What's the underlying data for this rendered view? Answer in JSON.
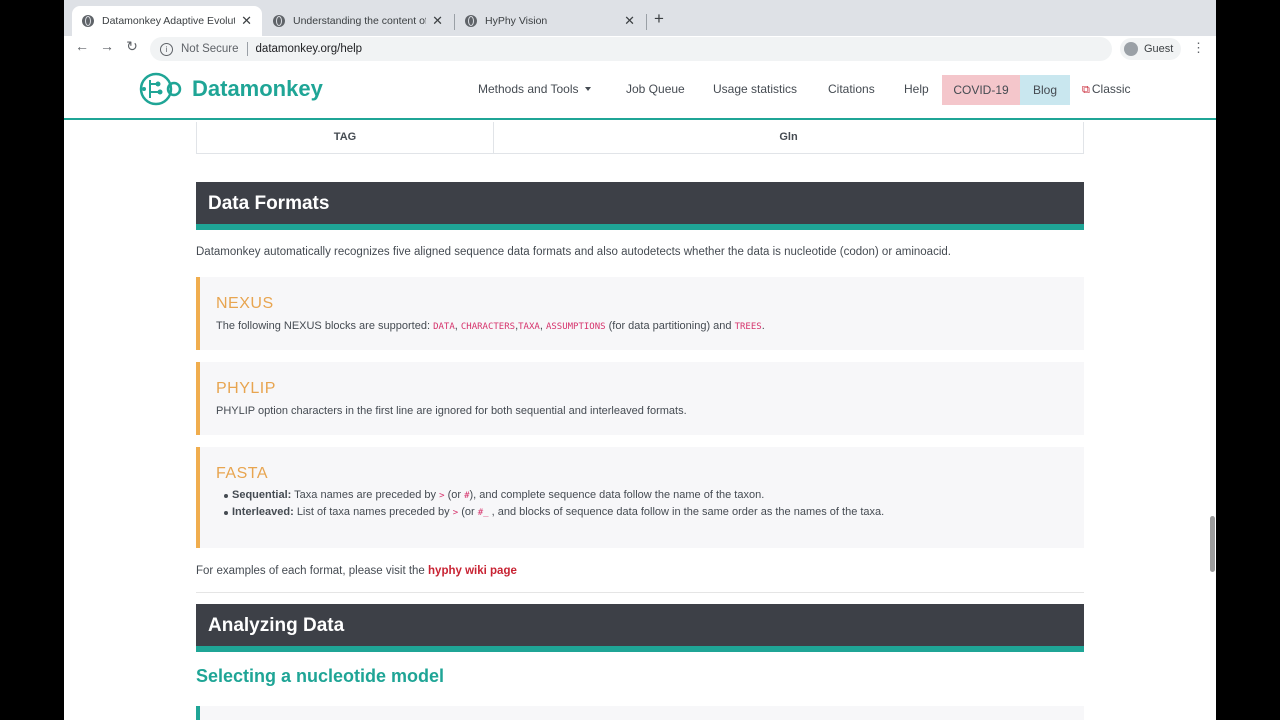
{
  "browser": {
    "tabs": [
      {
        "title": "Datamonkey Adaptive Evolution Server",
        "icon": "globe-icon",
        "active": true
      },
      {
        "title": "Understanding the content of the",
        "icon": "globe-icon",
        "active": false
      },
      {
        "title": "HyPhy Vision",
        "icon": "globe-icon",
        "active": false
      }
    ],
    "security_label": "Not Secure",
    "url": "datamonkey.org/help",
    "profile_label": "Guest"
  },
  "site": {
    "logo_text": "Datamonkey",
    "nav": {
      "methods": "Methods and Tools",
      "queue": "Job Queue",
      "usage": "Usage statistics",
      "citations": "Citations",
      "help": "Help",
      "covid": "COVID-19",
      "blog": "Blog",
      "classic": "Classic"
    }
  },
  "table_row": {
    "tag": "TAG",
    "aa": "Gln"
  },
  "data_formats": {
    "heading": "Data Formats",
    "intro": "Datamonkey automatically recognizes five aligned sequence data formats and also autodetects whether the data is nucleotide (codon) or aminoacid.",
    "nexus": {
      "title": "NEXUS",
      "text_pre": "The following NEXUS blocks are supported:",
      "code_data": "DATA",
      "code_characters": "CHARACTERS",
      "code_taxa": "TAXA",
      "code_assumptions": "ASSUMPTIONS",
      "text_mid": "(for data partitioning) and",
      "code_trees": "TREES"
    },
    "phylip": {
      "title": "PHYLIP",
      "text": "PHYLIP option characters in the first line are ignored for both sequential and interleaved formats."
    },
    "fasta": {
      "title": "FASTA",
      "seq_label": "Sequential:",
      "seq_pre": "Taxa names are preceded by",
      "seq_code1": ">",
      "seq_or": "(or",
      "seq_code2": "#",
      "seq_post": "), and complete sequence data follow the name of the taxon.",
      "int_label": "Interleaved:",
      "int_pre": "List of taxa names preceded by",
      "int_code1": ">",
      "int_or": "(or",
      "int_code2": "#_",
      "int_post": ", and blocks of sequence data follow in the same order as the names of the taxa."
    },
    "examples_pre": "For examples of each format, please visit the",
    "examples_link": "hyphy wiki page"
  },
  "analyzing": {
    "heading": "Analyzing Data",
    "subheading": "Selecting a nucleotide model"
  }
}
